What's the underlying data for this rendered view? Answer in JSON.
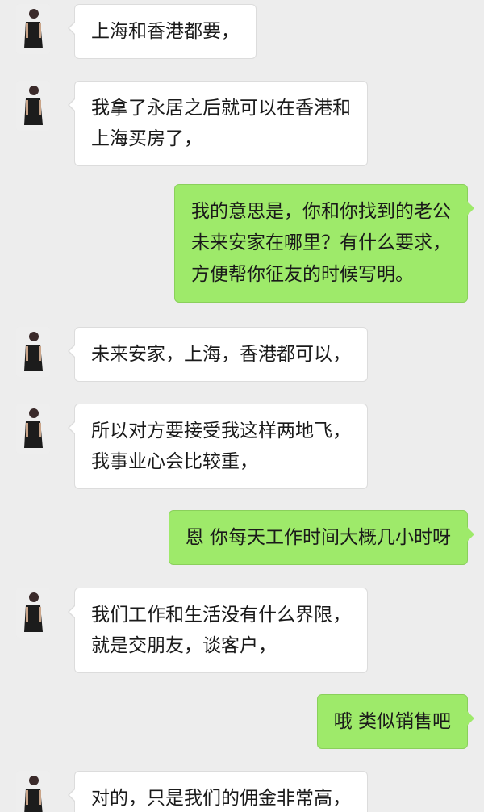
{
  "messages": [
    {
      "side": "left",
      "lines": [
        "上海和香港都要，"
      ]
    },
    {
      "side": "left",
      "lines": [
        "我拿了永居之后就可以在香港和",
        "上海买房了，"
      ]
    },
    {
      "side": "right",
      "lines": [
        "我的意思是，你和你找到的老公",
        "未来安家在哪里？有什么要求，",
        "方便帮你征友的时候写明。"
      ]
    },
    {
      "side": "left",
      "lines": [
        "未来安家，上海，香港都可以，"
      ]
    },
    {
      "side": "left",
      "lines": [
        "所以对方要接受我这样两地飞，",
        "我事业心会比较重，"
      ]
    },
    {
      "side": "right",
      "lines": [
        "恩 你每天工作时间大概几小时呀"
      ]
    },
    {
      "side": "left",
      "lines": [
        "我们工作和生活没有什么界限，",
        "就是交朋友，谈客户，"
      ]
    },
    {
      "side": "right",
      "lines": [
        "哦 类似销售吧"
      ]
    },
    {
      "side": "left",
      "lines": [
        "对的，只是我们的佣金非常高，"
      ]
    }
  ]
}
